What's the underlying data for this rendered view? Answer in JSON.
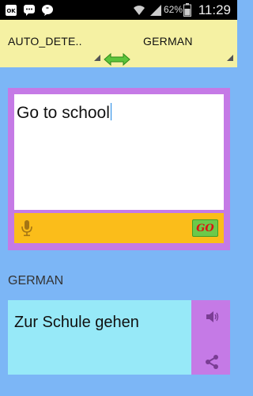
{
  "status_bar": {
    "battery_percent": "62%",
    "time": "11:29",
    "notification_icons": [
      "okx-icon",
      "messenger-icon",
      "chat-icon"
    ],
    "system_icons": [
      "wifi-icon",
      "signal-icon",
      "battery-icon"
    ]
  },
  "language_bar": {
    "source_language": "AUTO_DETE..",
    "target_language": "GERMAN",
    "swap_icon": "swap-arrows-icon",
    "background_color": "#f5f1a3",
    "accent_color": "#5cc43a"
  },
  "input": {
    "text": "Go to school",
    "mic_icon": "microphone-icon",
    "go_label": "GO",
    "panel_color": "#c57ae6",
    "action_bar_color": "#fbbd1a"
  },
  "output": {
    "language_label": "GERMAN",
    "text": "Zur Schule gehen",
    "speaker_icon": "speaker-icon",
    "share_icon": "share-icon",
    "text_bg_color": "#97e9f8"
  }
}
